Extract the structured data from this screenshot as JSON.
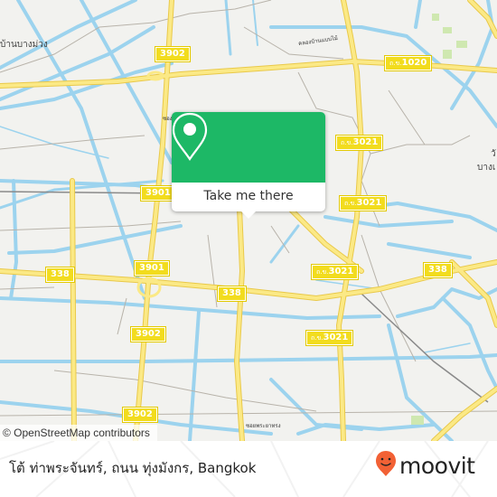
{
  "map": {
    "place_labels": [
      {
        "text": "บ้านบางม่วง"
      },
      {
        "text": "วั"
      },
      {
        "text": "บางเ"
      }
    ],
    "small_labels": [
      {
        "text": "คลองบ้านแบบไม้"
      },
      {
        "text": "ซอยพระยาทรง"
      },
      {
        "text": "ซอง"
      }
    ],
    "road_shields": [
      {
        "prefix": "",
        "number": "3902"
      },
      {
        "prefix": "ถ.ข.",
        "number": "1020"
      },
      {
        "prefix": "ถ.ข.",
        "number": "3021"
      },
      {
        "prefix": "ถ.ข.",
        "number": "3021"
      },
      {
        "prefix": "",
        "number": "3901"
      },
      {
        "prefix": "",
        "number": "3901"
      },
      {
        "prefix": "",
        "number": "338"
      },
      {
        "prefix": "",
        "number": "338"
      },
      {
        "prefix": "ถ.ข.",
        "number": "3021"
      },
      {
        "prefix": "",
        "number": "338"
      },
      {
        "prefix": "",
        "number": "3902"
      },
      {
        "prefix": "ถ.ข.",
        "number": "3021"
      },
      {
        "prefix": "",
        "number": "3902"
      }
    ],
    "attribution": "© OpenStreetMap contributors"
  },
  "popup": {
    "icon": "location-pin-icon",
    "button_label": "Take me there",
    "accent_color": "#1db866"
  },
  "footer": {
    "place_title": "โต้ ท่าพระจันทร์, ถนน ทุ่งมังกร, Bangkok",
    "brand": "moovit",
    "brand_color": "#f26135"
  }
}
